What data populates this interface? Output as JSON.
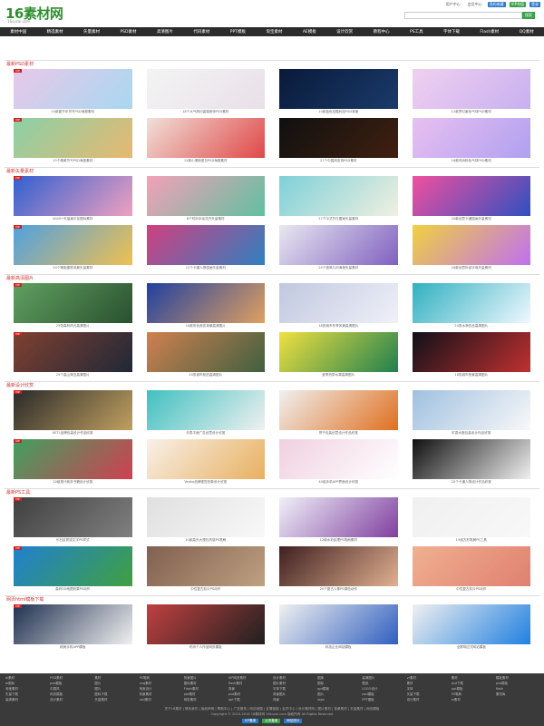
{
  "header": {
    "logo": "16素材网",
    "logo_sub": "16sucai.com",
    "toplinks": [
      "用户中心",
      "会员中心",
      "我的收藏",
      "VIP充值",
      "登录"
    ],
    "search_placeholder": "",
    "search_button": "搜索"
  },
  "nav": [
    "素材中国",
    "精选素材",
    "矢量素材",
    "PSD素材",
    "高清图片",
    "代码素材",
    "PPT模板",
    "淘宝素材",
    "AE模板",
    "设计欣赏",
    "教程中心",
    "PS工具",
    "字体下载",
    "Flash素材",
    "QQ素材"
  ],
  "sections": [
    {
      "title": "最新PSD素材",
      "items": [
        "10款春节年货节PSD海报素材",
        "18个大气简约高端首饰PSD素材",
        "10款蓝色炫酷科技PSD背景",
        "12款梦幻紫色气球PSD素材",
        "15个精美节气PSD海报素材",
        "12款小清新夏日PSD海报素材",
        "27个中国风庆祝PSD素材",
        "16款时尚粉色气球PSD素材"
      ],
      "colors": [
        [
          "#e8c8e8",
          "#a8d8f0"
        ],
        [
          "#f4f4f4",
          "#e8e0e8"
        ],
        [
          "#0a1a3a",
          "#1a3a6a"
        ],
        [
          "#f0d0f0",
          "#c8b0f0"
        ],
        [
          "#8ad0a8",
          "#e8b870"
        ],
        [
          "#f0e0d8",
          "#e04848"
        ],
        [
          "#101010",
          "#402010"
        ],
        [
          "#e8c0f0",
          "#b0a0f0"
        ]
      ]
    },
    {
      "title": "最新矢量素材",
      "items": [
        "4000+矢量扁平化图标素材",
        "8个时尚手绘花卉矢量素材",
        "27个中式节日图案矢量素材",
        "10款创意卡通插画矢量素材",
        "20个等距建筑场景矢量素材",
        "12个卡通人物插画矢量素材",
        "24个极简几何海报矢量素材",
        "16款创意折纸字母矢量素材"
      ],
      "colors": [
        [
          "#3060d0",
          "#f0a0c0"
        ],
        [
          "#f4a0b8",
          "#60c0a0"
        ],
        [
          "#7ed0d8",
          "#f0f0e0"
        ],
        [
          "#f050a0",
          "#3050c0"
        ],
        [
          "#50a0e0",
          "#f0c050"
        ],
        [
          "#d04080",
          "#3080c0"
        ],
        [
          "#e8e8f0",
          "#8060c0"
        ],
        [
          "#f0d040",
          "#c070f0"
        ]
      ]
    },
    {
      "title": "最新高清图片",
      "items": [
        "25张森林风光高清图片",
        "10款彩色渐变背景高清图片",
        "18张城市冬季风景高清图片",
        "24张水滴饮品高清图片",
        "25个高山湖泊高清图片",
        "20张城市航拍高清图片",
        "夏季热带水果高清图片",
        "18张城市夜景高清图片"
      ],
      "colors": [
        [
          "#60a060",
          "#2a5030"
        ],
        [
          "#2040a0",
          "#e0a060"
        ],
        [
          "#c0c8e0",
          "#f0f0f8"
        ],
        [
          "#30b0c0",
          "#f0f8ff"
        ],
        [
          "#804030",
          "#202838"
        ],
        [
          "#d08050",
          "#406040"
        ],
        [
          "#f0e040",
          "#208050"
        ],
        [
          "#101018",
          "#c03030"
        ]
      ]
    },
    {
      "title": "最新设计欣赏",
      "items": [
        "KETL品牌包装设计作品欣赏",
        "手表平面广告创意设计欣赏",
        "饼干包装创意设计作品欣赏",
        "矿泉水瓶包装设计作品欣赏",
        "20组现代商务书籍设计欣赏",
        "Vedka品牌视觉形象设计欣赏",
        "40组手机APP界面设计欣赏",
        "20个卡通人物设计作品欣赏"
      ],
      "colors": [
        [
          "#2a2a2a",
          "#c0a060"
        ],
        [
          "#40c0c0",
          "#f0f0f0"
        ],
        [
          "#f0f0f0",
          "#e07020"
        ],
        [
          "#a0c0e0",
          "#f8f8f8"
        ],
        [
          "#40a060",
          "#d04050"
        ],
        [
          "#f8f0e8",
          "#e8b060"
        ],
        [
          "#f0d0e0",
          "#ffffff"
        ],
        [
          "#101010",
          "#f0f0f0"
        ]
      ]
    },
    {
      "title": "最新PS工具",
      "items": [
        "长石纹质感文字PS样式",
        "10款高光大理石质感PS笔刷",
        "12款水彩纹理PS笔刷素材",
        "15组方形笔刷PS工具",
        "森林3D地图效果PS动作",
        "中性复古胶片PS动作",
        "20个复古人像PS调色动作",
        "中性复古胶片PS动作"
      ],
      "colors": [
        [
          "#404040",
          "#808080"
        ],
        [
          "#e0e0e0",
          "#f8f8f8"
        ],
        [
          "#f0f0f8",
          "#8040a0"
        ],
        [
          "#f0f0f0",
          "#f8f8f8"
        ],
        [
          "#2080d0",
          "#40a040"
        ],
        [
          "#806050",
          "#c0a080"
        ],
        [
          "#402020",
          "#e0b090"
        ],
        [
          "#f0b090",
          "#e08070"
        ]
      ]
    },
    {
      "title": "网页html模板下载",
      "items": [
        "精美手机APP模板",
        "时尚个人作品网页模板",
        "科技企业网站模板",
        "全屏响应式网站模板"
      ],
      "colors": [
        [
          "#203050",
          "#f0f0f0"
        ],
        [
          "#c04040",
          "#202020"
        ],
        [
          "#f0f0f0",
          "#3060c0"
        ],
        [
          "#f0f0f0",
          "#2080e0"
        ]
      ]
    }
  ],
  "footer": {
    "links": [
      "ai素材",
      "PSD素材",
      "素材",
      "PS笔刷",
      "背景图片",
      "VIP网页素材",
      "设计素材",
      "图库",
      "高清图片",
      "vr素材",
      "素材",
      "模板素材",
      "ai图标",
      "psd模板",
      "图片",
      "png素材",
      "图标素材",
      "flash素材",
      "图片素材",
      "图标",
      "壁纸",
      "素材",
      "psd下载",
      "psd模板",
      "淘宝素材",
      "中国风",
      "图片",
      "淘宝设计",
      "Flash素材",
      "背景",
      "字体下载",
      "ppt模板",
      "LOGO设计",
      "字体",
      "ppt模板",
      "flash",
      "矢量下载",
      "网页模板",
      "图标下载",
      "背景素材",
      "ppt素材",
      "psd素材",
      "背景图片",
      "图片",
      "psd模板",
      "矢量下载",
      "PS笔刷",
      "素材库",
      "高清素材",
      "设计素材",
      "矢量素材",
      "psd素材",
      "网页素材",
      "ppt下载",
      "背景",
      "logo",
      "PPT模板",
      "设计素材",
      "ai素材"
    ],
    "bar1": "关于16素材 | 联系我们 | 版权声明 | 帮助中心 | 广告服务 | 网站地图 | 友情链接 | 会员中心 | 设计素材网 | 图片素材 | 背景素材 | 矢量素材 | 网页模板",
    "bar2": "Copyright © 2010-2016 16素材网 16sucai.com 版权所有 All Rights Reserved",
    "badges": [
      "ICP备案",
      "公安备案",
      "网站统计"
    ]
  }
}
